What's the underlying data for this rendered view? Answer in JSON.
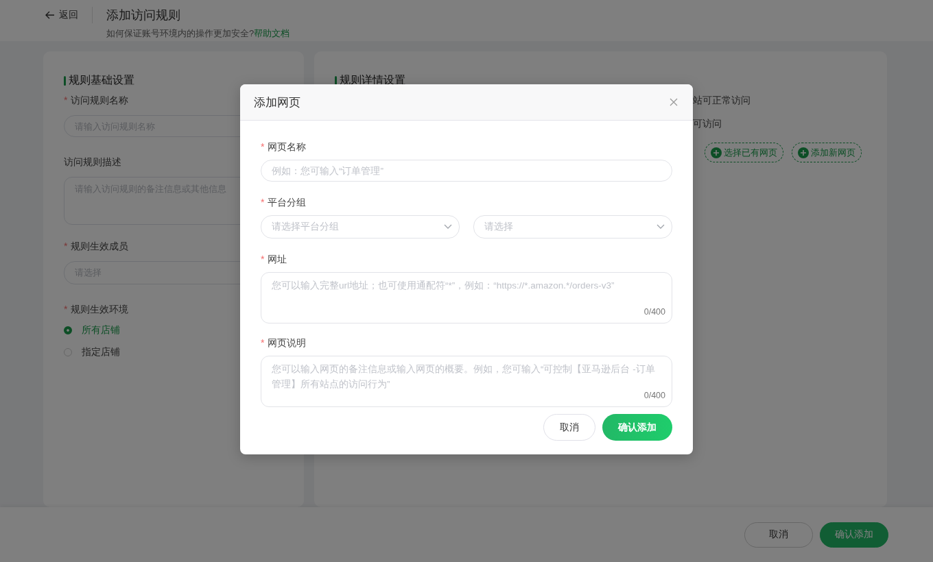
{
  "header": {
    "back": "返回",
    "title": "添加访问规则",
    "hint": "如何保证账号环境内的操作更加安全?",
    "help_link": "帮助文档"
  },
  "basic": {
    "title": "规则基础设置",
    "fields": [
      {
        "label": "访问规则名称",
        "required_mark": "*",
        "kind": "input",
        "placeholder": "请输入访问规则名称"
      },
      {
        "label": "访问规则描述",
        "kind": "textarea",
        "placeholder": "请输入访问规则的备注信息或其他信息"
      },
      {
        "label": "规则生效成员",
        "required_mark": "*",
        "kind": "select",
        "placeholder": "请选择"
      },
      {
        "label": "规则生效环境",
        "required_mark": "*",
        "kind": "radio",
        "options": [
          {
            "label": "所有店铺",
            "selected": true
          },
          {
            "label": "指定店铺",
            "selected": false
          }
        ]
      }
    ]
  },
  "detail": {
    "title": "规则详情设置",
    "lines": [
      "站可正常访问",
      "可访问"
    ],
    "actions": [
      "选择已有网页",
      "添加新网页"
    ]
  },
  "footer": {
    "buttons": [
      {
        "label": "取消",
        "kind": "secondary"
      },
      {
        "label": "确认添加",
        "kind": "primary"
      }
    ]
  },
  "dialog": {
    "title": "添加网页",
    "fields": [
      {
        "label": "网页名称",
        "required_mark": "*",
        "kind": "input",
        "placeholder": "例如：您可输入“订单管理”"
      },
      {
        "label": "平台分组",
        "required_mark": "*",
        "kind": "selects",
        "placeholders": [
          "请选择平台分组",
          "请选择"
        ]
      },
      {
        "label": "网址",
        "required_mark": "*",
        "kind": "textarea",
        "placeholder": "您可以输入完整url地址；也可使用通配符“*”，例如：“https://*.amazon.*/orders-v3”",
        "counter": "0/400"
      },
      {
        "label": "网页说明",
        "required_mark": "*",
        "kind": "textarea",
        "placeholder": "您可以输入网页的备注信息或输入网页的概要。例如，您可输入“可控制【亚马逊后台 -订单管理】所有站点的访问行为”",
        "counter": "0/400"
      }
    ],
    "buttons": [
      {
        "label": "取消",
        "kind": "secondary"
      },
      {
        "label": "确认添加",
        "kind": "primary"
      }
    ]
  }
}
